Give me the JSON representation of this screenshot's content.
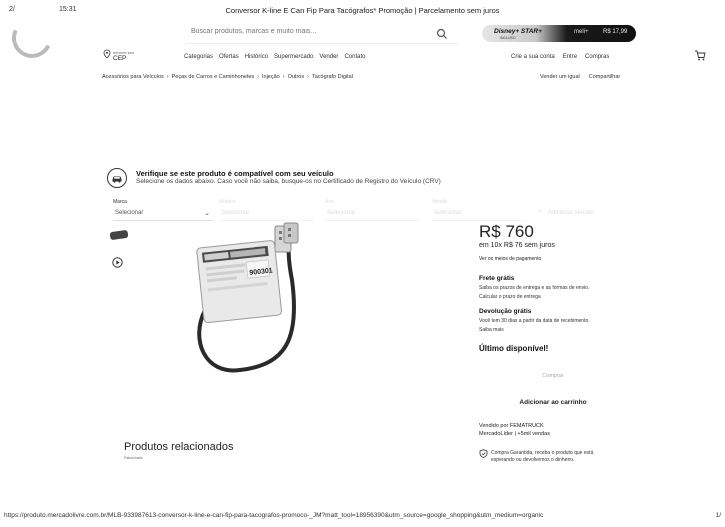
{
  "print": {
    "left": "2/",
    "time": "15:31",
    "title": "Conversor K-line E Can Fip Para Tacógrafos* Promoção | Parcelamento sem juros",
    "url": "https://produto.mercadolivre.com.br/MLB-933987613-conversor-k-line-e-can-fip-para-tacografos-promoco-_JM?matt_tool=18956390&utm_source=google_shopping&utm_medium=organic",
    "page": "1/"
  },
  "search": {
    "placeholder": "Buscar produtos, marcas e muito mais..."
  },
  "banner": {
    "logo": "Disney+ STAR+",
    "sublogo": "INCLUSO",
    "mais": "meli+",
    "price": "R$ 17,99"
  },
  "address": {
    "line1": "Informe seu",
    "line2": "CEP"
  },
  "nav": [
    "Categorias",
    "Ofertas",
    "Histórico",
    "Supermercado",
    "Vender",
    "Contato"
  ],
  "user": [
    "Crie a sua conta",
    "Entre",
    "Compras"
  ],
  "breadcrumb": [
    "Acessórios para Veículos",
    "›",
    "Peças de Carros e Caminhonetes",
    "›",
    "Injeção",
    "›",
    "Outros",
    "›",
    "Tacógrafo Digital"
  ],
  "actions": [
    "Vender um igual",
    "Compartilhar"
  ],
  "compat": {
    "title": "Verifique se este produto é compatível com seu veículo",
    "subtitle": "Selecione os dados abaixo. Caso você não saiba, busque-os no Certificado de Registro do Veículo (CRV)",
    "marca_label": "Marca",
    "marca_value": "Selecionar",
    "faint_labels": [
      "Modelo",
      "Ano",
      "Versão"
    ],
    "faint_values": [
      "Selecionar",
      "Selecionar",
      "Selecionar"
    ],
    "add_label": "Adicionar veículo"
  },
  "product": {
    "device_serial": "900301",
    "price": "R$ 760",
    "installments": "em 10x R$ 76 sem juros",
    "payment_link": "Ver os meios de pagamento",
    "shipping_title": "Frete grátis",
    "shipping_text": "Saiba os prazos de entrega e as formas de envio.",
    "shipping_link": "Calcular o prazo de entrega",
    "return_title": "Devolução grátis",
    "return_text": "Você tem 30 dias a partir da data de recebimento.",
    "return_link": "Saiba mais",
    "stock": "Último disponível!",
    "buy_label": "Comprar",
    "cart_label": "Adicionar ao carrinho",
    "seller_line1": "Vendido por FEMATRUCK",
    "seller_line2": "MercadoLíder | +5mil vendas",
    "guarantee1": "Compra Garantida, receba o produto que está",
    "guarantee2": "esperando ou devolvemos o dinheiro."
  },
  "related": {
    "title": "Produtos relacionados",
    "subtitle": "Patrocinado"
  }
}
